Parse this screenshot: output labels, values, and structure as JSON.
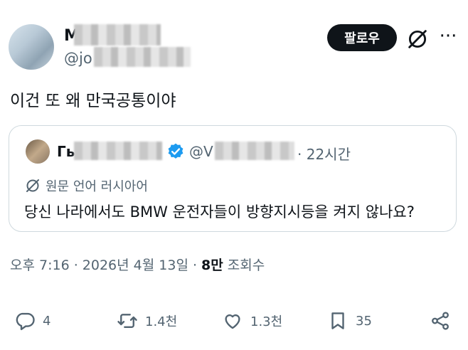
{
  "post": {
    "author_name_visible": "M",
    "author_handle_visible": "@jo",
    "follow_label": "팔로우",
    "text": "이건 또 왜 만국공통이야"
  },
  "quote": {
    "author_name_visible": "Гь",
    "handle_visible": "@V",
    "time": "· 22시간",
    "translation_label": "원문 언어 러시아어",
    "text": "당신 나라에서도 BMW 운전자들이 방향지시등을 켜지 않나요?"
  },
  "meta": {
    "timestamp": "오후 7:16 · 2026년 4월 13일 · ",
    "views_count": "8만",
    "views_label": " 조회수"
  },
  "actions": {
    "reply_count": "4",
    "repost_count": "1.4천",
    "like_count": "1.3천",
    "bookmark_count": "35"
  },
  "icons": [
    "grok-icon",
    "more-icon",
    "verified-icon",
    "translate-icon",
    "reply-icon",
    "repost-icon",
    "like-icon",
    "bookmark-icon",
    "share-icon"
  ],
  "colors": {
    "verified": "#1d9bf0",
    "secondary_text": "#536471",
    "follow_button": "#0f1419"
  }
}
